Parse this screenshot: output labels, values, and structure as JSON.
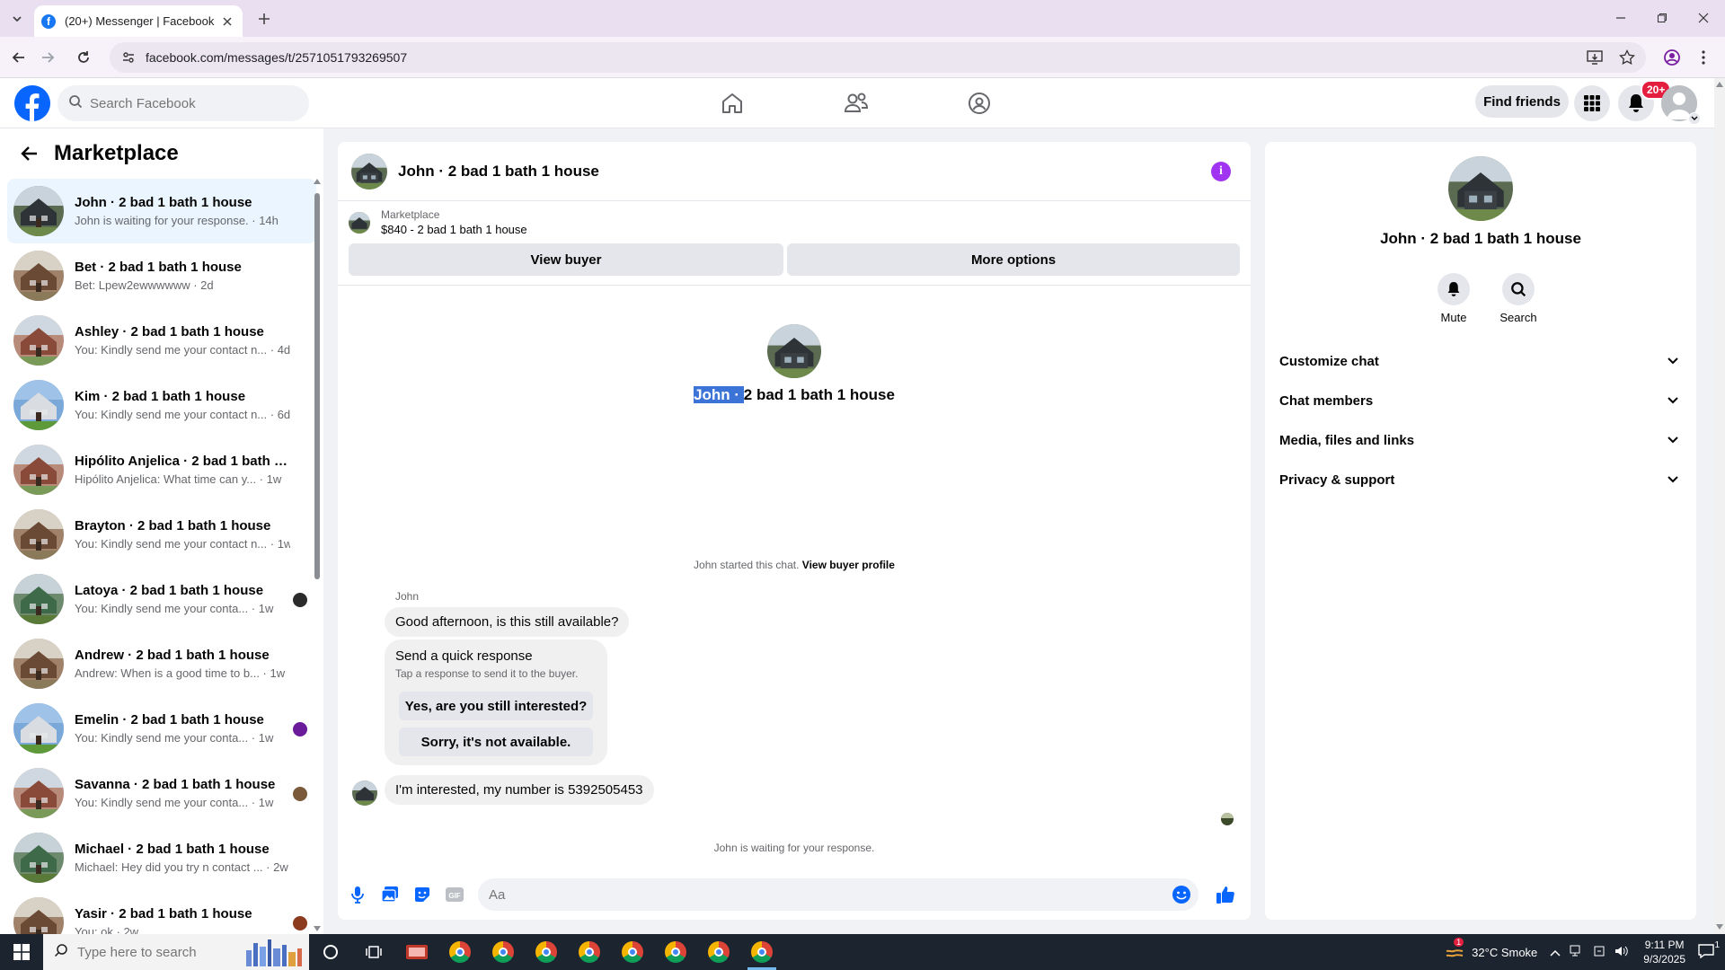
{
  "browser": {
    "tab_title": "(20+) Messenger | Facebook",
    "url": "facebook.com/messages/t/2571051793269507"
  },
  "fb": {
    "search_placeholder": "Search Facebook",
    "find_friends": "Find friends",
    "notif_count": "20+"
  },
  "sidebar": {
    "title": "Marketplace",
    "chats": [
      {
        "name": "John · 2 bad 1 bath 1 house",
        "sub": "John is waiting for your response. · 14h",
        "active": true,
        "thumb": "house-dark"
      },
      {
        "name": "Bet · 2 bad 1 bath 1 house",
        "sub": "Bet: Lpew2ewwwwww · 2d",
        "thumb": "house-brown"
      },
      {
        "name": "Ashley · 2 bad 1 bath 1 house",
        "sub": "You: Kindly send me your contact n... · 4d",
        "thumb": "house-red"
      },
      {
        "name": "Kim · 2 bad 1 bath 1 house",
        "sub": "You: Kindly send me your contact n... · 6d",
        "thumb": "house-blue"
      },
      {
        "name": "Hipólito Anjelica · 2 bad 1 bath 1...",
        "sub": "Hipólito Anjelica: What time can y... · 1w",
        "thumb": "house-red"
      },
      {
        "name": "Brayton · 2 bad 1 bath 1 house",
        "sub": "You: Kindly send me your contact n... · 1w",
        "thumb": "house-brown"
      },
      {
        "name": "Latoya · 2 bad 1 bath 1 house",
        "sub": "You: Kindly send me your conta... · 1w",
        "thumb": "house-green",
        "mini": "#2b2b2b"
      },
      {
        "name": "Andrew · 2 bad 1 bath 1 house",
        "sub": "Andrew: When is a good time to b... · 1w",
        "thumb": "house-brown"
      },
      {
        "name": "Emelin · 2 bad 1 bath 1 house",
        "sub": "You: Kindly send me your conta... · 1w",
        "thumb": "house-blue",
        "mini": "#6a1b9a"
      },
      {
        "name": "Savanna · 2 bad 1 bath 1 house",
        "sub": "You: Kindly send me your conta... · 1w",
        "thumb": "house-red",
        "mini": "#7a5a3a"
      },
      {
        "name": "Michael · 2 bad 1 bath 1 house",
        "sub": "Michael: Hey did you try n contact ... · 2w",
        "thumb": "house-green"
      },
      {
        "name": "Yasir · 2 bad 1 bath 1 house",
        "sub": "You: ok · 2w",
        "thumb": "house-brown",
        "mini": "#8d3b1f"
      }
    ]
  },
  "conversation": {
    "title": "John · 2 bad 1 bath 1 house",
    "marketplace_label": "Marketplace",
    "listing": "$840 - 2 bad 1 bath 1 house",
    "view_buyer": "View buyer",
    "more_options": "More options",
    "intro_selected": "John · ",
    "intro_rest": "2 bad 1 bath 1 house",
    "started_text": "John started this chat.",
    "view_buyer_profile": "View buyer profile",
    "sender": "John",
    "msg1": "Good afternoon, is this still available?",
    "quick_title": "Send a quick response",
    "quick_sub": "Tap a response to send it to the buyer.",
    "quick_yes": "Yes, are you still interested?",
    "quick_no": "Sorry, it's not available.",
    "msg2": "I'm interested, my number is 5392505453",
    "waiting": "John is waiting for your response.",
    "composer_placeholder": "Aa"
  },
  "details": {
    "name": "John · 2 bad 1 bath 1 house",
    "mute": "Mute",
    "search": "Search",
    "sections": [
      "Customize chat",
      "Chat members",
      "Media, files and links",
      "Privacy & support"
    ]
  },
  "taskbar": {
    "search_placeholder": "Type here to search",
    "weather": "32°C  Smoke",
    "time": "9:11 PM",
    "date": "9/3/2025",
    "notif_count": "1"
  },
  "colors": {
    "fb_blue": "#0866ff",
    "active_chat_bg": "#ebf5ff",
    "info_purple": "#a034f0"
  }
}
